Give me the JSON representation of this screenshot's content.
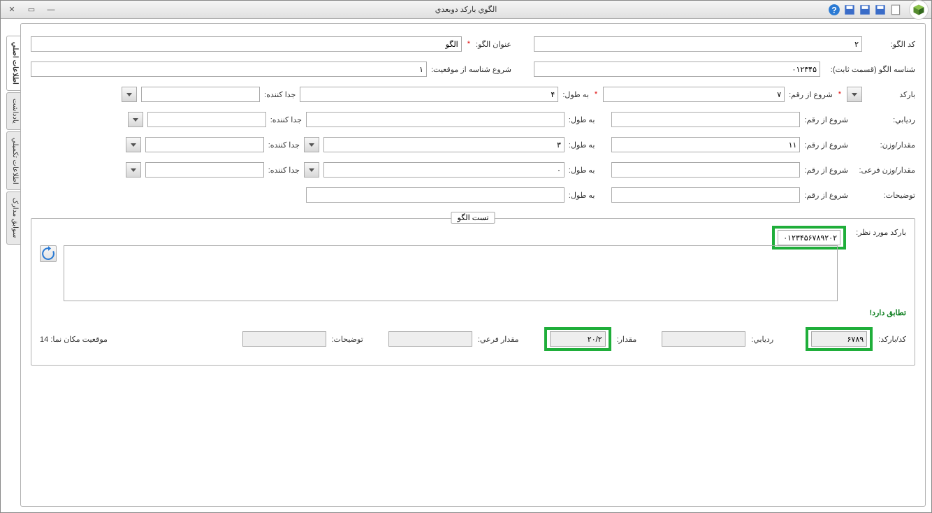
{
  "window": {
    "title": "الگوي بارکد دوبعدي"
  },
  "toolbar": {
    "close_glyph": "✕",
    "max_glyph": "▭",
    "min_glyph": "—"
  },
  "tabs": {
    "t1": "اطلاعات اصلي",
    "t2": "يادداشت",
    "t3": "اطلاعات تکميلي",
    "t4": "سوابق مدارک"
  },
  "labels": {
    "code": "کد الگو:",
    "title": "عنوان الگو:",
    "fixed_part": "شناسه الگو (قسمت ثابت):",
    "start_pos": "شروع شناسه از موقعیت:",
    "barcode": "بارکد",
    "start_digit": "شروع از رقم:",
    "length": "به طول:",
    "separator": "جدا کننده:",
    "tracking": "رديابي:",
    "amount_weight": "مقدار/وزن:",
    "amount_weight_sub": "مقدار/وزن فرعی:",
    "description": "توضيحات:",
    "test_legend": "تست الگو",
    "target_barcode": "بارکد مورد نظر:",
    "match": "تطابق دارد!",
    "res_code": "کد/بارکد:",
    "res_tracking": "رديابي:",
    "res_amount": "مقدار:",
    "res_sub": "مقدار فرعي:",
    "res_desc": "توضيحات:",
    "cursor_prefix": "موقعیت مکان نما:"
  },
  "values": {
    "code": "۲",
    "title": "الگو",
    "fixed_part": "۰۱۲۳۴۵",
    "start_pos": "۱",
    "barcode_start": "۷",
    "barcode_len": "۴",
    "tracking_start": "",
    "tracking_len": "",
    "amount_start": "۱۱",
    "amount_len": "۳",
    "sub_start": "",
    "sub_len": "۰",
    "desc_start": "",
    "desc_len": "",
    "target_barcode": "۰۱۲۳۴۵۶۷۸۹۲۰۲",
    "res_code": "۶۷۸۹",
    "res_tracking": "",
    "res_amount": "۲۰/۲",
    "res_sub": "",
    "res_desc": "",
    "cursor_pos": "14"
  }
}
